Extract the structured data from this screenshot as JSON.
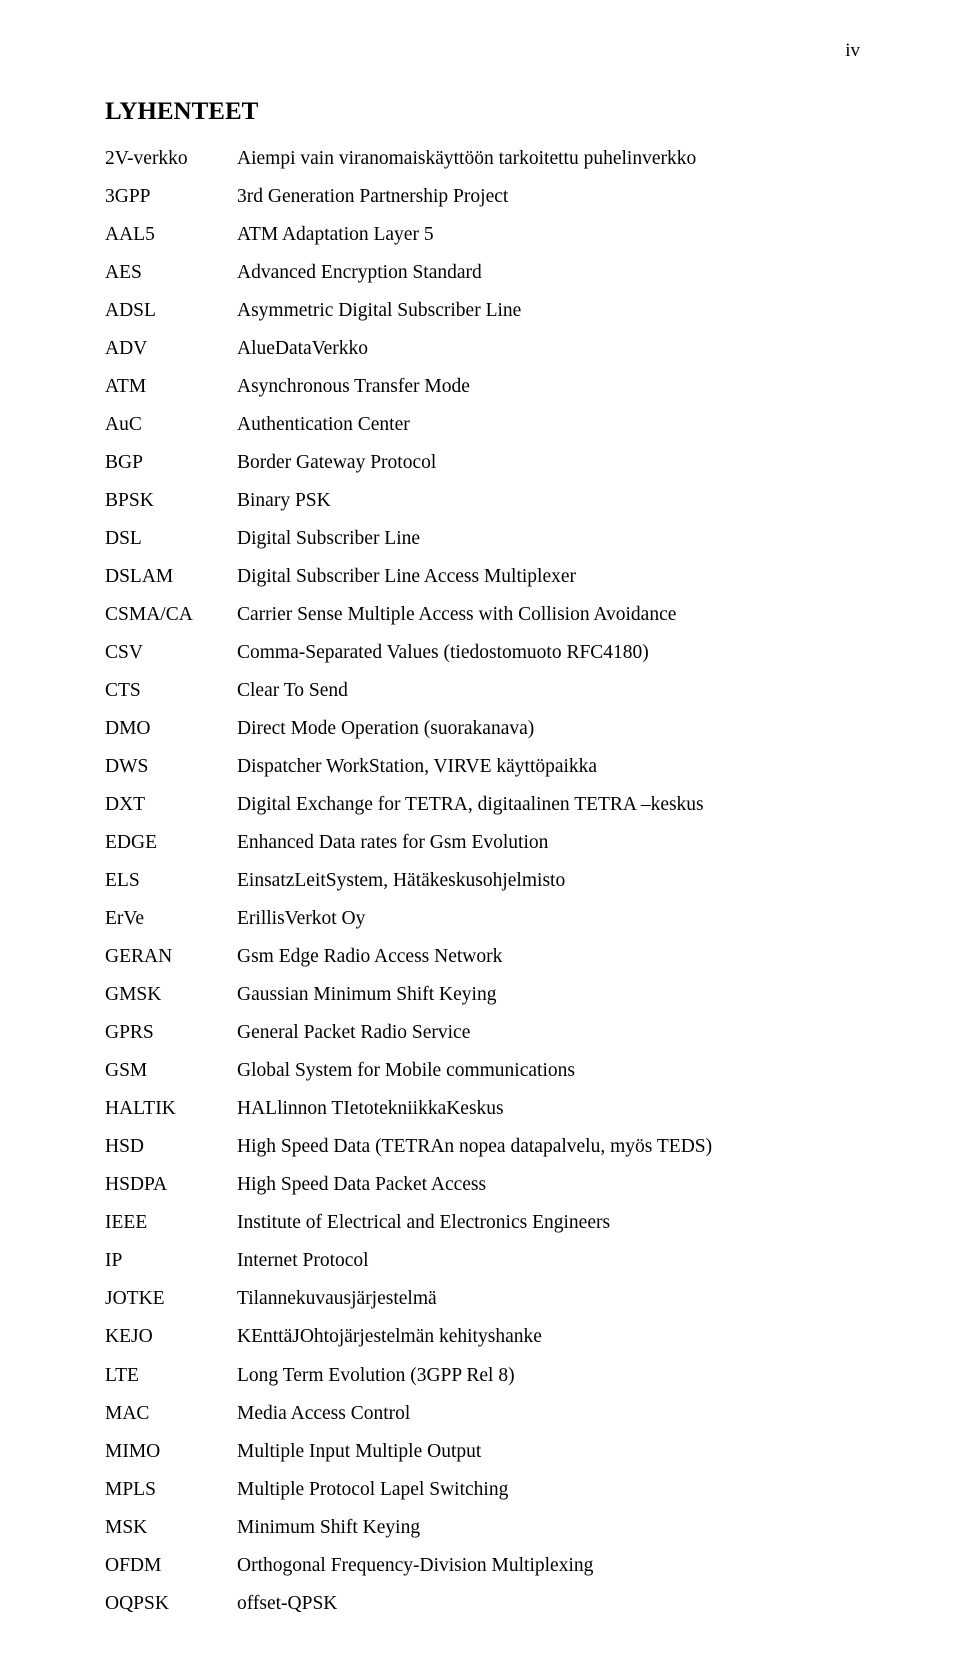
{
  "page_number": "iv",
  "title": "LYHENTEET",
  "entries": [
    {
      "abbr": "2V-verkko",
      "def": "Aiempi vain viranomaiskäyttöön tarkoitettu puhelinverkko"
    },
    {
      "abbr": "3GPP",
      "def": "3rd Generation Partnership Project"
    },
    {
      "abbr": "AAL5",
      "def": "ATM Adaptation Layer 5"
    },
    {
      "abbr": "AES",
      "def": "Advanced Encryption Standard"
    },
    {
      "abbr": "ADSL",
      "def": "Asymmetric Digital Subscriber Line"
    },
    {
      "abbr": "ADV",
      "def": "AlueDataVerkko"
    },
    {
      "abbr": "ATM",
      "def": "Asynchronous Transfer Mode"
    },
    {
      "abbr": "AuC",
      "def": "Authentication Center"
    },
    {
      "abbr": "BGP",
      "def": "Border Gateway Protocol"
    },
    {
      "abbr": "BPSK",
      "def": "Binary PSK"
    },
    {
      "abbr": "DSL",
      "def": "Digital Subscriber Line"
    },
    {
      "abbr": "DSLAM",
      "def": "Digital Subscriber Line Access Multiplexer"
    },
    {
      "abbr": "CSMA/CA",
      "def": "Carrier Sense Multiple Access with Collision Avoidance"
    },
    {
      "abbr": "CSV",
      "def": "Comma-Separated Values (tiedostomuoto RFC4180)"
    },
    {
      "abbr": "CTS",
      "def": "Clear To Send"
    },
    {
      "abbr": "DMO",
      "def": "Direct Mode Operation (suorakanava)"
    },
    {
      "abbr": "DWS",
      "def": "Dispatcher WorkStation, VIRVE käyttöpaikka"
    },
    {
      "abbr": "DXT",
      "def": "Digital Exchange for TETRA, digitaalinen TETRA –keskus"
    },
    {
      "abbr": "EDGE",
      "def": "Enhanced Data rates for Gsm Evolution"
    },
    {
      "abbr": "ELS",
      "def": "EinsatzLeitSystem, Hätäkeskusohjelmisto"
    },
    {
      "abbr": "ErVe",
      "def": "ErillisVerkot Oy"
    },
    {
      "abbr": "GERAN",
      "def": "Gsm Edge Radio Access Network"
    },
    {
      "abbr": "GMSK",
      "def": "Gaussian Minimum Shift Keying"
    },
    {
      "abbr": "GPRS",
      "def": "General Packet Radio Service"
    },
    {
      "abbr": "GSM",
      "def": "Global System for Mobile communications"
    },
    {
      "abbr": "HALTIK",
      "def": "HALlinnon TIetotekniikkaKeskus"
    },
    {
      "abbr": "HSD",
      "def": "High Speed Data (TETRAn nopea datapalvelu, myös TEDS)"
    },
    {
      "abbr": "HSDPA",
      "def": "High Speed Data Packet Access"
    },
    {
      "abbr": "IEEE",
      "def": "Institute of Electrical and Electronics Engineers"
    },
    {
      "abbr": "IP",
      "def": "Internet Protocol"
    },
    {
      "abbr": "JOTKE",
      "def": "Tilannekuvausjärjestelmä"
    },
    {
      "abbr": "KEJO",
      "def": "KEnttäJOhtojärjestelmän kehityshanke"
    },
    {
      "abbr": "LTE",
      "def": "Long Term Evolution (3GPP Rel 8)"
    },
    {
      "abbr": "MAC",
      "def": "Media Access Control"
    },
    {
      "abbr": "MIMO",
      "def": "Multiple Input Multiple Output"
    },
    {
      "abbr": "MPLS",
      "def": "Multiple Protocol Lapel Switching"
    },
    {
      "abbr": "MSK",
      "def": "Minimum Shift Keying"
    },
    {
      "abbr": "OFDM",
      "def": "Orthogonal Frequency-Division Multiplexing"
    },
    {
      "abbr": "OQPSK",
      "def": "offset-QPSK"
    }
  ]
}
